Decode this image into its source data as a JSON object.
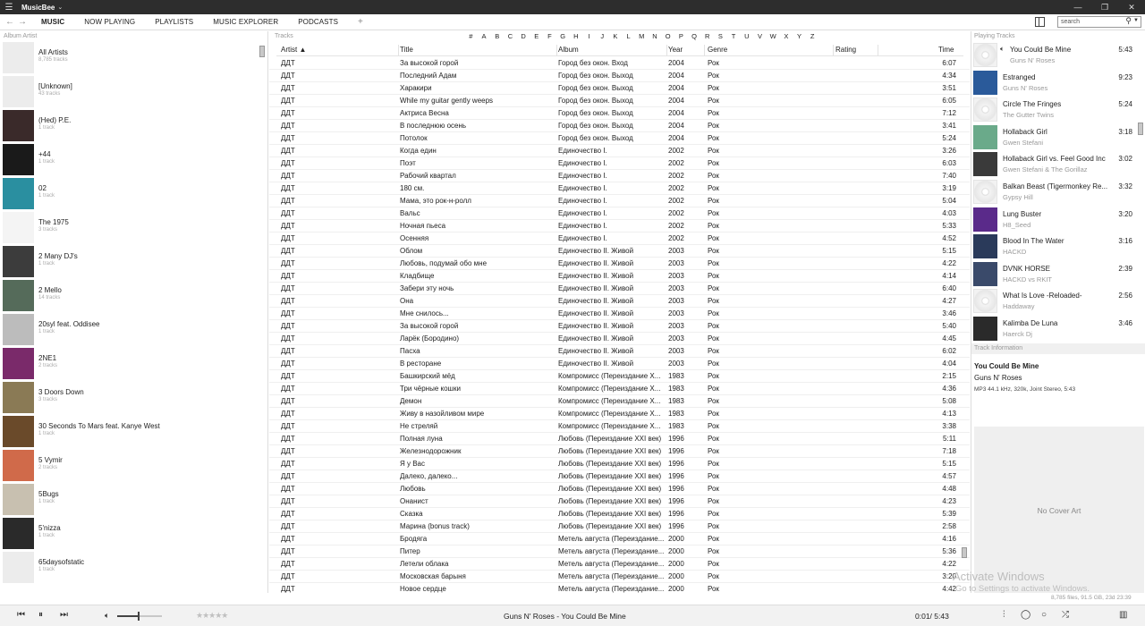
{
  "app": {
    "name": "MusicBee",
    "window_buttons": [
      "—",
      "❐",
      "✕"
    ]
  },
  "nav": {
    "tabs": [
      "MUSIC",
      "NOW PLAYING",
      "PLAYLISTS",
      "MUSIC EXPLORER",
      "PODCASTS"
    ],
    "add": "+",
    "search_placeholder": "search"
  },
  "left": {
    "header": "Album Artist",
    "artists": [
      {
        "name": "All Artists",
        "count": "8,785 tracks",
        "thumb": "#ececec"
      },
      {
        "name": "[Unknown]",
        "count": "43 tracks",
        "thumb": "#ececec"
      },
      {
        "name": "(Hed) P.E.",
        "count": "1 track",
        "thumb": "#3a2a2a"
      },
      {
        "name": "+44",
        "count": "1 track",
        "thumb": "#1a1a1a"
      },
      {
        "name": "02",
        "count": "1 track",
        "thumb": "#2a8fa0"
      },
      {
        "name": "The 1975",
        "count": "3 tracks",
        "thumb": "#f4f4f4"
      },
      {
        "name": "2 Many DJ's",
        "count": "1 track",
        "thumb": "#3c3c3c"
      },
      {
        "name": "2 Mello",
        "count": "14 tracks",
        "thumb": "#556b5a"
      },
      {
        "name": "20syl feat. Oddisee",
        "count": "1 track",
        "thumb": "#bcbcbc"
      },
      {
        "name": "2NE1",
        "count": "2 tracks",
        "thumb": "#7a2a6a"
      },
      {
        "name": "3 Doors Down",
        "count": "3 tracks",
        "thumb": "#8a7a55"
      },
      {
        "name": "30 Seconds To Mars feat. Kanye West",
        "count": "1 track",
        "thumb": "#6a4a2a"
      },
      {
        "name": "5 Vymir",
        "count": "2 tracks",
        "thumb": "#d06a4a"
      },
      {
        "name": "5Bugs",
        "count": "1 track",
        "thumb": "#c8c0b0"
      },
      {
        "name": "5'nizza",
        "count": "1 track",
        "thumb": "#2a2a2a"
      },
      {
        "name": "65daysofstatic",
        "count": "1 track",
        "thumb": "#ececec"
      }
    ]
  },
  "tracks": {
    "header": "Tracks",
    "alphabet": [
      "#",
      "A",
      "B",
      "C",
      "D",
      "E",
      "F",
      "G",
      "H",
      "I",
      "J",
      "K",
      "L",
      "M",
      "N",
      "O",
      "P",
      "Q",
      "R",
      "S",
      "T",
      "U",
      "V",
      "W",
      "X",
      "Y",
      "Z"
    ],
    "columns": {
      "artist": "Artist ▲",
      "title": "Title",
      "album": "Album",
      "year": "Year",
      "genre": "Genre",
      "rating": "Rating",
      "time": "Time"
    },
    "rows": [
      [
        "ДДТ",
        "За высокой горой",
        "Город без окон. Вход",
        "2004",
        "Рок",
        "6:07"
      ],
      [
        "ДДТ",
        "Последний Адам",
        "Город без окон. Выход",
        "2004",
        "Рок",
        "4:34"
      ],
      [
        "ДДТ",
        "Харакири",
        "Город без окон. Выход",
        "2004",
        "Рок",
        "3:51"
      ],
      [
        "ДДТ",
        "While my guitar gently weeps",
        "Город без окон. Выход",
        "2004",
        "Рок",
        "6:05"
      ],
      [
        "ДДТ",
        "Актриса Весна",
        "Город без окон. Выход",
        "2004",
        "Рок",
        "7:12"
      ],
      [
        "ДДТ",
        "В последнюю осень",
        "Город без окон. Выход",
        "2004",
        "Рок",
        "3:41"
      ],
      [
        "ДДТ",
        "Потолок",
        "Город без окон. Выход",
        "2004",
        "Рок",
        "5:24"
      ],
      [
        "ДДТ",
        "Когда един",
        "Единочество I.",
        "2002",
        "Рок",
        "3:26"
      ],
      [
        "ДДТ",
        "Поэт",
        "Единочество I.",
        "2002",
        "Рок",
        "6:03"
      ],
      [
        "ДДТ",
        "Рабочий квартал",
        "Единочество I.",
        "2002",
        "Рок",
        "7:40"
      ],
      [
        "ДДТ",
        "180 см.",
        "Единочество I.",
        "2002",
        "Рок",
        "3:19"
      ],
      [
        "ДДТ",
        "Мама, это рок-н-ролл",
        "Единочество I.",
        "2002",
        "Рок",
        "5:04"
      ],
      [
        "ДДТ",
        "Вальс",
        "Единочество I.",
        "2002",
        "Рок",
        "4:03"
      ],
      [
        "ДДТ",
        "Ночная пьеса",
        "Единочество I.",
        "2002",
        "Рок",
        "5:33"
      ],
      [
        "ДДТ",
        "Осенняя",
        "Единочество I.",
        "2002",
        "Рок",
        "4:52"
      ],
      [
        "ДДТ",
        "Облом",
        "Единочество II. Живой",
        "2003",
        "Рок",
        "5:15"
      ],
      [
        "ДДТ",
        "Любовь, подумай обо мне",
        "Единочество II. Живой",
        "2003",
        "Рок",
        "4:22"
      ],
      [
        "ДДТ",
        "Кладбище",
        "Единочество II. Живой",
        "2003",
        "Рок",
        "4:14"
      ],
      [
        "ДДТ",
        "Забери эту ночь",
        "Единочество II. Живой",
        "2003",
        "Рок",
        "6:40"
      ],
      [
        "ДДТ",
        "Она",
        "Единочество II. Живой",
        "2003",
        "Рок",
        "4:27"
      ],
      [
        "ДДТ",
        "Мне снилось...",
        "Единочество II. Живой",
        "2003",
        "Рок",
        "3:46"
      ],
      [
        "ДДТ",
        "За высокой горой",
        "Единочество II. Живой",
        "2003",
        "Рок",
        "5:40"
      ],
      [
        "ДДТ",
        "Ларёк (Бородино)",
        "Единочество II. Живой",
        "2003",
        "Рок",
        "4:45"
      ],
      [
        "ДДТ",
        "Пасха",
        "Единочество II. Живой",
        "2003",
        "Рок",
        "6:02"
      ],
      [
        "ДДТ",
        "В ресторане",
        "Единочество II. Живой",
        "2003",
        "Рок",
        "4:04"
      ],
      [
        "ДДТ",
        "Башкирский мёд",
        "Компромисс (Переиздание X...",
        "1983",
        "Рок",
        "2:15"
      ],
      [
        "ДДТ",
        "Три чёрные кошки",
        "Компромисс (Переиздание X...",
        "1983",
        "Рок",
        "4:36"
      ],
      [
        "ДДТ",
        "Демон",
        "Компромисс (Переиздание X...",
        "1983",
        "Рок",
        "5:08"
      ],
      [
        "ДДТ",
        "Живу в назойливом мире",
        "Компромисс (Переиздание X...",
        "1983",
        "Рок",
        "4:13"
      ],
      [
        "ДДТ",
        "Не стреляй",
        "Компромисс (Переиздание X...",
        "1983",
        "Рок",
        "3:38"
      ],
      [
        "ДДТ",
        "Полная луна",
        "Любовь (Переиздание XXI век)",
        "1996",
        "Рок",
        "5:11"
      ],
      [
        "ДДТ",
        "Железнодорожник",
        "Любовь (Переиздание XXI век)",
        "1996",
        "Рок",
        "7:18"
      ],
      [
        "ДДТ",
        "Я у Вас",
        "Любовь (Переиздание XXI век)",
        "1996",
        "Рок",
        "5:15"
      ],
      [
        "ДДТ",
        "Далеко, далеко...",
        "Любовь (Переиздание XXI век)",
        "1996",
        "Рок",
        "4:57"
      ],
      [
        "ДДТ",
        "Любовь",
        "Любовь (Переиздание XXI век)",
        "1996",
        "Рок",
        "4:48"
      ],
      [
        "ДДТ",
        "Онанист",
        "Любовь (Переиздание XXI век)",
        "1996",
        "Рок",
        "4:23"
      ],
      [
        "ДДТ",
        "Сказка",
        "Любовь (Переиздание XXI век)",
        "1996",
        "Рок",
        "5:39"
      ],
      [
        "ДДТ",
        "Марина (bonus track)",
        "Любовь (Переиздание XXI век)",
        "1996",
        "Рок",
        "2:58"
      ],
      [
        "ДДТ",
        "Бродяга",
        "Метель августа (Переиздание...",
        "2000",
        "Рок",
        "4:16"
      ],
      [
        "ДДТ",
        "Питер",
        "Метель августа (Переиздание...",
        "2000",
        "Рок",
        "5:36"
      ],
      [
        "ДДТ",
        "Летели облака",
        "Метель августа (Переиздание...",
        "2000",
        "Рок",
        "4:22"
      ],
      [
        "ДДТ",
        "Московская барыня",
        "Метель августа (Переиздание...",
        "2000",
        "Рок",
        "3:20"
      ],
      [
        "ДДТ",
        "Новое сердце",
        "Метель августа (Переиздание...",
        "2000",
        "Рок",
        "4:42"
      ]
    ]
  },
  "playing": {
    "header": "Playing Tracks",
    "tracks": [
      {
        "title": "You Could Be Mine",
        "artist": "Guns N' Roses",
        "dur": "5:43",
        "thumb": "cd",
        "current": true
      },
      {
        "title": "Estranged",
        "artist": "Guns N' Roses",
        "dur": "9:23",
        "thumb": "#2a5a9a"
      },
      {
        "title": "Circle The Fringes",
        "artist": "The Gutter Twins",
        "dur": "5:24",
        "thumb": "cd"
      },
      {
        "title": "Hollaback Girl",
        "artist": "Gwen Stefani",
        "dur": "3:18",
        "thumb": "#6aaa8a"
      },
      {
        "title": "Hollaback Girl vs. Feel Good Inc",
        "artist": "Gwen Stefani & The Gorillaz",
        "dur": "3:02",
        "thumb": "#3a3a3a"
      },
      {
        "title": "Balkan Beast (Tigermonkey Re...",
        "artist": "Gypsy Hill",
        "dur": "3:32",
        "thumb": "cd"
      },
      {
        "title": "Lung Buster",
        "artist": "H8_Seed",
        "dur": "3:20",
        "thumb": "#5a2a8a"
      },
      {
        "title": "Blood In The Water",
        "artist": "HACKD",
        "dur": "3:16",
        "thumb": "#2a3a5a"
      },
      {
        "title": "DVNK HORSE",
        "artist": "HACKD vs RKIT",
        "dur": "2:39",
        "thumb": "#3a4a6a"
      },
      {
        "title": "What Is Love -Reloaded-",
        "artist": "Haddaway",
        "dur": "2:56",
        "thumb": "cd"
      },
      {
        "title": "Kalimba De Luna",
        "artist": "Haerck Dj",
        "dur": "3:46",
        "thumb": "#2a2a2a"
      }
    ],
    "info_header": "Track Information",
    "info_title": "You Could Be Mine",
    "info_artist": "Guns N' Roses",
    "info_meta": "MP3 44.1 kHz, 320k, Joint Stereo, 5:43",
    "no_art": "No Cover Art"
  },
  "watermark": {
    "line1": "Activate Windows",
    "line2": "Go to Settings to activate Windows."
  },
  "stats": "8,785 files, 91.5 GB, 23d 23:39",
  "player": {
    "now_playing": "Guns N' Roses - You Could Be Mine",
    "time": "0:01/ 5:43",
    "stars": "★★★★★",
    "volume_fraction": 0.5
  }
}
